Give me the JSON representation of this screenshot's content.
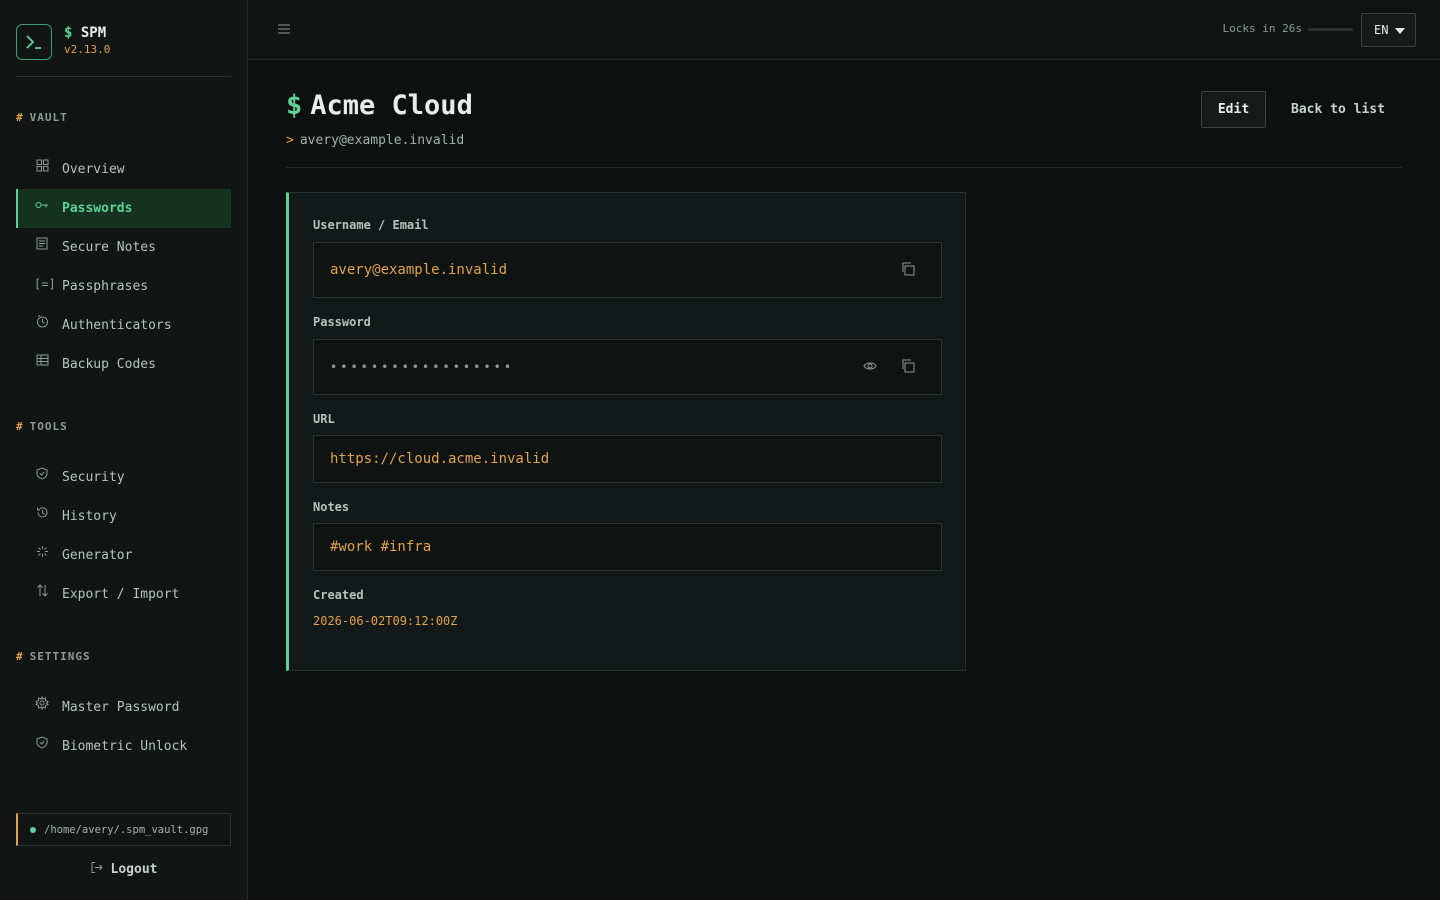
{
  "app": {
    "name": "SPM",
    "prompt": "$",
    "version": "v2.13.0"
  },
  "sidebar": {
    "sections": [
      {
        "title": "VAULT",
        "items": [
          {
            "label": "Overview",
            "icon": "grid-icon"
          },
          {
            "label": "Passwords",
            "icon": "key-icon",
            "active": true
          },
          {
            "label": "Secure Notes",
            "icon": "note-icon"
          },
          {
            "label": "Passphrases",
            "icon": "bracket-icon"
          },
          {
            "label": "Authenticators",
            "icon": "clock-icon"
          },
          {
            "label": "Backup Codes",
            "icon": "table-icon"
          }
        ]
      },
      {
        "title": "TOOLS",
        "items": [
          {
            "label": "Security",
            "icon": "shield-icon"
          },
          {
            "label": "History",
            "icon": "history-icon"
          },
          {
            "label": "Generator",
            "icon": "sparkle-icon"
          },
          {
            "label": "Export / Import",
            "icon": "arrows-updown-icon"
          }
        ]
      },
      {
        "title": "SETTINGS",
        "items": [
          {
            "label": "Master Password",
            "icon": "gear-icon"
          },
          {
            "label": "Biometric Unlock",
            "icon": "shield-icon"
          }
        ]
      }
    ],
    "vault_path": "/home/avery/.spm_vault.gpg",
    "logout_label": "Logout"
  },
  "topbar": {
    "lock_text": "Locks in 26s",
    "lock_progress": 0.0,
    "language": "EN"
  },
  "entry": {
    "title": "Acme Cloud",
    "subtitle": "avery@example.invalid",
    "edit_label": "Edit",
    "back_label": "Back to list",
    "fields": {
      "username_label": "Username / Email",
      "username_value": "avery@example.invalid",
      "password_label": "Password",
      "password_value": "••••••••••••••••••",
      "url_label": "URL",
      "url_value": "https://cloud.acme.invalid",
      "notes_label": "Notes",
      "notes_value": "#work #infra",
      "created_label": "Created",
      "created_value": "2026-06-02T09:12:00Z"
    }
  },
  "colors": {
    "accent": "#5fd397",
    "secondary": "#e0a24a",
    "background": "#0d1110"
  }
}
